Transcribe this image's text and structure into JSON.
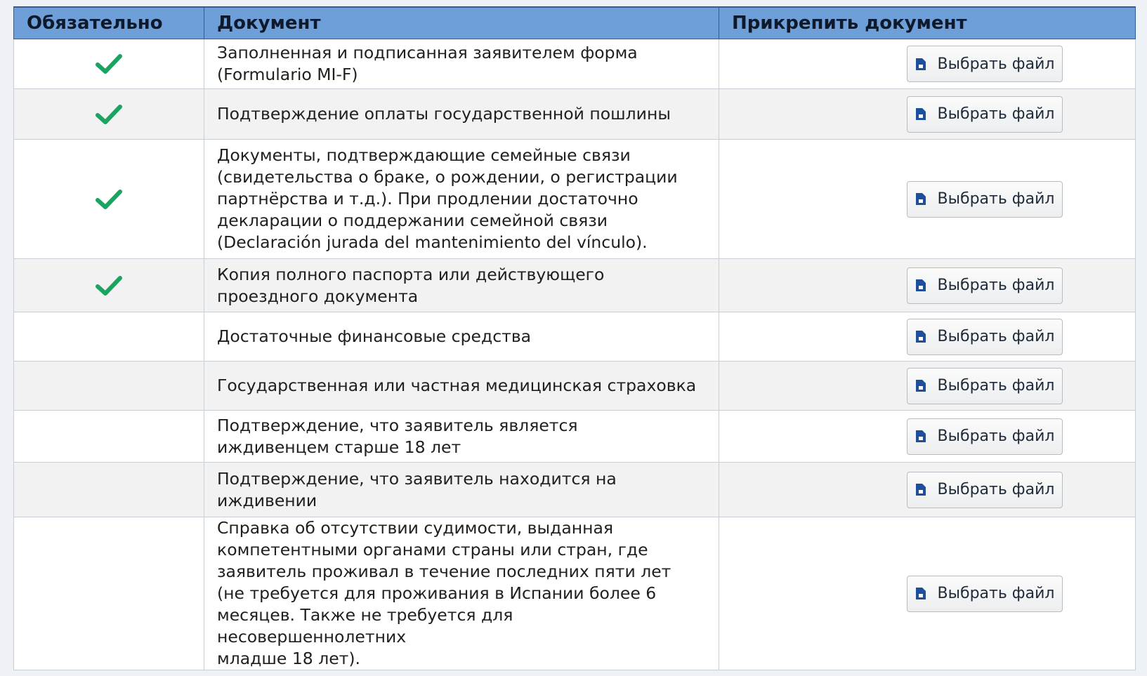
{
  "headers": {
    "required": "Обязательно",
    "document": "Документ",
    "attach": "Прикрепить документ"
  },
  "rows": [
    {
      "required": true,
      "text": "Заполненная и подписанная заявителем форма\n(Formulario MI-F)",
      "button": "Выбрать файл"
    },
    {
      "required": true,
      "text": "Подтверждение оплаты государственной пошлины",
      "button": "Выбрать файл"
    },
    {
      "required": true,
      "text": "Документы, подтверждающие семейные связи\n(свидетельства о браке, о рождении, о регистрации\nпартнёрства и т.д.). При продлении достаточно\nдекларации о поддержании семейной связи\n(Declaración jurada del mantenimiento del vínculo).",
      "button": "Выбрать файл"
    },
    {
      "required": true,
      "text": "Копия полного паспорта или действующего\nпроездного документа",
      "button": "Выбрать файл"
    },
    {
      "required": false,
      "text": "Достаточные финансовые средства",
      "button": "Выбрать файл"
    },
    {
      "required": false,
      "text": "Государственная или частная медицинская страховка",
      "button": "Выбрать файл"
    },
    {
      "required": false,
      "text": "Подтверждение, что заявитель является\nиждивенцем старше 18 лет",
      "button": "Выбрать файл"
    },
    {
      "required": false,
      "text": "Подтверждение, что заявитель находится на\nиждивении",
      "button": "Выбрать файл"
    },
    {
      "required": false,
      "text": "Справка об отсутствии судимости, выданная\nкомпетентными органами страны или стран, где\nзаявитель проживал в течение последних пяти лет\n(не требуется для проживания в Испании более 6\nмесяцев. Также не требуется для несовершеннолетних\nмладше 18 лет).",
      "button": "Выбрать файл"
    }
  ],
  "icons": {
    "required": "checkmark-icon",
    "button": "file-icon"
  },
  "colors": {
    "header_bg": "#6e9fd9",
    "check": "#1aa361",
    "file_icon": "#1e4f9c"
  }
}
